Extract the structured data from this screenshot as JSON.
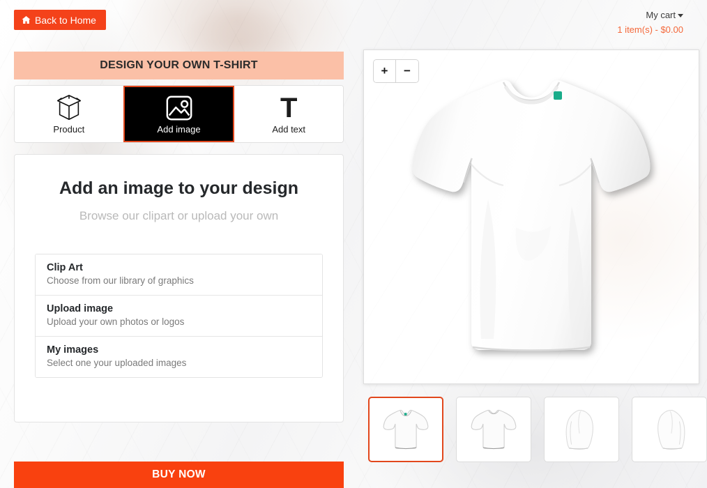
{
  "header": {
    "back_home_label": "Back to Home",
    "back_home_icon": "home-icon",
    "cart_label": "My cart",
    "cart_summary": "1 item(s) - $0.00",
    "accent_orange": "#f4421a",
    "cart_summary_color": "#f4683a"
  },
  "banner": {
    "title": "DESIGN YOUR OWN T-SHIRT",
    "background": "#fbc0a7"
  },
  "tool_tabs": [
    {
      "label": "Product",
      "icon": "box-icon",
      "active": false
    },
    {
      "label": "Add image",
      "icon": "image-icon",
      "active": true
    },
    {
      "label": "Add text",
      "icon": "text-t-icon",
      "active": false
    }
  ],
  "panel": {
    "title": "Add an image to your design",
    "subtitle": "Browse our clipart or upload your own",
    "options": [
      {
        "title": "Clip Art",
        "desc": "Choose from our library of graphics"
      },
      {
        "title": "Upload image",
        "desc": "Upload your own photos or logos"
      },
      {
        "title": "My images",
        "desc": "Select one your uploaded images"
      }
    ]
  },
  "buy_now": {
    "label": "BUY NOW",
    "background": "#f9410f"
  },
  "preview": {
    "zoom_in_label": "+",
    "zoom_out_label": "−",
    "product_color": "#ffffff",
    "collar_tag_color": "#1aac8a"
  },
  "thumbnails": [
    {
      "view": "front",
      "selected": true
    },
    {
      "view": "back",
      "selected": false
    },
    {
      "view": "left-side",
      "selected": false
    },
    {
      "view": "right-side",
      "selected": false
    }
  ]
}
